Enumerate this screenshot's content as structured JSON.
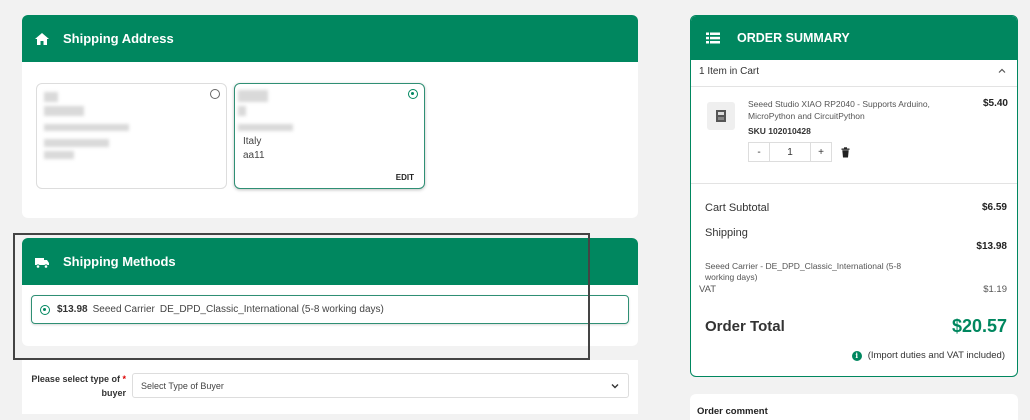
{
  "shipping_address": {
    "title": "Shipping Address",
    "card2_country": "Italy",
    "card2_line": "aa11",
    "edit_label": "EDIT"
  },
  "shipping_methods": {
    "title": "Shipping Methods",
    "method": {
      "price": "$13.98",
      "carrier": "Seeed Carrier",
      "service": "DE_DPD_Classic_International (5-8 working days)"
    }
  },
  "buyer": {
    "label": "Please select type of",
    "label_line2": "buyer",
    "required_mark": "*",
    "placeholder": "Select Type of Buyer"
  },
  "order_summary": {
    "title": "ORDER SUMMARY",
    "cart_count": "1 Item in Cart",
    "product": {
      "name": "Seeed Studio XIAO RP2040 - Supports Arduino, MicroPython and CircuitPython",
      "price": "$5.40",
      "sku": "SKU 102010428",
      "quantity": "1",
      "minus": "-",
      "plus": "+"
    },
    "subtotal_label": "Cart Subtotal",
    "subtotal_value": "$6.59",
    "shipping_label": "Shipping",
    "shipping_detail": "Seeed Carrier - DE_DPD_Classic_International (5-8 working days)",
    "shipping_value": "$13.98",
    "vat_label": "VAT",
    "vat_value": "$1.19",
    "total_label": "Order Total",
    "total_value": "$20.57",
    "note": "(Import duties and VAT included)",
    "info_glyph": "i"
  },
  "order_comment": {
    "title": "Order comment"
  },
  "colors": {
    "accent": "#00875f"
  },
  "icons": [
    "home-icon",
    "truck-icon",
    "list-icon",
    "chevron-up-icon",
    "chevron-down-icon",
    "trash-icon",
    "info-icon",
    "radio-icon"
  ]
}
